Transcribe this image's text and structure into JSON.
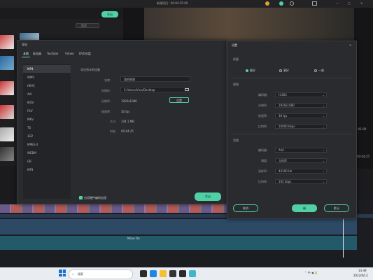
{
  "app": {
    "title": "新建项目 : 00:04:25:00",
    "export_button": "导出",
    "media_search_placeholder": "搜索"
  },
  "export_dialog": {
    "title": "导出",
    "tabs": [
      "本地",
      "驱动器",
      "YouTube",
      "Vimeo",
      "DVD光盘"
    ],
    "active_tab": "本地",
    "formats": [
      "MP4",
      "WMV",
      "HEVC",
      "AVI",
      "MOV",
      "F4V",
      "MKV",
      "TS",
      "3GP",
      "MPEG-2",
      "WEBM",
      "GIF",
      "MP3"
    ],
    "selected_format": "MP4",
    "section_title": "导出到本地设备",
    "name_label": "名称:",
    "name_value": "我的视频",
    "save_label": "存储在:",
    "save_value": "C:/Users/Vivo/Desktop",
    "resolution_label": "分辨率:",
    "resolution_value": "1920x1080",
    "settings_button": "设置",
    "framerate_label": "帧速率:",
    "framerate_value": "30 fps",
    "size_label": "大小:",
    "size_value": "104.1 MB",
    "duration_label": "时长:",
    "duration_value": "00:04:25",
    "hw_accel_label": "启用硬件编码加速",
    "export_button": "导出"
  },
  "settings_dialog": {
    "title": "设置",
    "quality_section": "质量",
    "quality_options": [
      "最好",
      "更好",
      "一般"
    ],
    "quality_selected": "最好",
    "video_section": "视频",
    "video_rows": [
      {
        "label": "编码器:",
        "value": "H.264"
      },
      {
        "label": "分辨率:",
        "value": "1920x1080"
      },
      {
        "label": "帧速率:",
        "value": "30 fps"
      },
      {
        "label": "比特率:",
        "value": "10000 kbps"
      }
    ],
    "audio_section": "音频",
    "audio_rows": [
      {
        "label": "编码器:",
        "value": "AAC"
      },
      {
        "label": "通道:",
        "value": "立体声"
      },
      {
        "label": "采样率:",
        "value": "44100 Hz"
      },
      {
        "label": "比特率:",
        "value": "192 kbps"
      }
    ],
    "cancel_button": "取消",
    "ok_button": "确",
    "default_button": "默认"
  },
  "timeline": {
    "clip_label": "Move On",
    "time_a": "1:01:00",
    "time_b": "00:04:25"
  },
  "taskbar": {
    "search_label": "搜索",
    "time": "13:49",
    "date": "2022/6/13"
  },
  "colors": {
    "accent": "#4fd1a5",
    "dialog_bg": "#2a2b2e",
    "app_bg": "#1b1b1e"
  }
}
